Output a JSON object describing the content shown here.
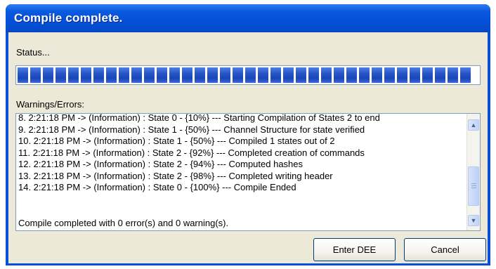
{
  "window": {
    "title": "Compile complete."
  },
  "status": {
    "label": "Status...",
    "progress_percent": 100
  },
  "log": {
    "label": "Warnings/Errors:",
    "lines": [
      "8. 2:21:18 PM -> (Information) : State 0 - {10%} --- Starting Compilation of States 2 to end",
      "9. 2:21:18 PM -> (Information) : State 1 - {50%} --- Channel Structure for state verified",
      "10. 2:21:18 PM -> (Information) : State 1 - {50%} --- Compiled 1 states out of 2",
      "11. 2:21:18 PM -> (Information) : State 2 - {92%} --- Completed creation of commands",
      "12. 2:21:18 PM -> (Information) : State 2 - {94%} --- Computed hashes",
      "13. 2:21:18 PM -> (Information) : State 2 - {98%} --- Completed writing header",
      "14. 2:21:18 PM -> (Information) : State 0 - {100%} --- Compile Ended"
    ],
    "summary": "Compile completed with 0 error(s) and 0 warning(s)."
  },
  "buttons": {
    "enter_label": "Enter DEE",
    "cancel_label": "Cancel"
  },
  "icons": {
    "scroll_up": "scroll-up-arrow-icon",
    "scroll_down": "scroll-down-arrow-icon"
  },
  "colors": {
    "titlebar": "#0550d8",
    "progress_block": "#2655c8",
    "dialog_face": "#ece9d8"
  }
}
